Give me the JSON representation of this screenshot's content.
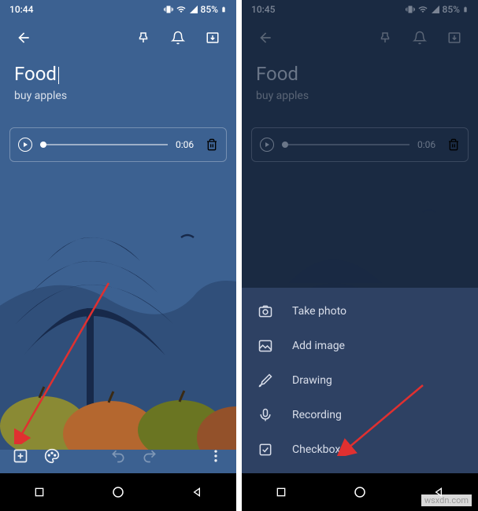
{
  "status": {
    "time_left": "10:44",
    "time_right": "10:45",
    "signal": "▲",
    "wifi": "▼",
    "battery_pct": "85%"
  },
  "topbar": {
    "back": "back",
    "pin": "pin",
    "reminder": "bell",
    "archive": "archive"
  },
  "note": {
    "title": "Food",
    "body": "buy apples"
  },
  "audio": {
    "duration": "0:06"
  },
  "editbar": {
    "add": "add",
    "palette": "palette",
    "undo": "undo",
    "redo": "redo",
    "more": "more"
  },
  "menu": {
    "items": [
      {
        "icon": "camera",
        "label": "Take photo"
      },
      {
        "icon": "image",
        "label": "Add image"
      },
      {
        "icon": "brush",
        "label": "Drawing"
      },
      {
        "icon": "mic",
        "label": "Recording"
      },
      {
        "icon": "checkbox",
        "label": "Checkboxes"
      }
    ]
  },
  "watermark": "wsxdn.com"
}
